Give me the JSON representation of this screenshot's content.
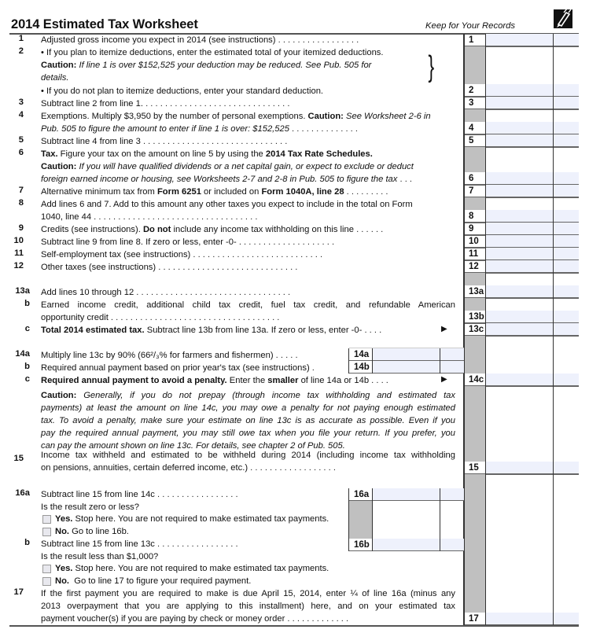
{
  "header": {
    "title": "2014 Estimated Tax Worksheet",
    "keep_note": "Keep for Your Records",
    "icon": "pencil-icon"
  },
  "lines": {
    "l1": {
      "num": "1",
      "text": "Adjusted gross income you expect in 2014 (see instructions)",
      "box": "1"
    },
    "l2": {
      "num": "2",
      "bullet1": "• If you plan to itemize deductions, enter the estimated total of your itemized deductions.",
      "caution_label": "Caution:",
      "caution_text": "If line 1 is over $152,525 your deduction may be reduced.  See Pub. 505 for",
      "caution_text2": "details.",
      "bullet2": "• If you do not plan to itemize deductions, enter your standard deduction.",
      "box": "2"
    },
    "l3": {
      "num": "3",
      "text": "Subtract line 2 from line 1.",
      "box": "3"
    },
    "l4": {
      "num": "4",
      "text": "Exemptions. Multiply $3,950 by the number of personal exemptions.",
      "caution_label": "Caution:",
      "caution_text": "See Worksheet 2-6 in",
      "text2": "Pub. 505 to figure the amount to enter if line 1 is over: $152,525",
      "box": "4"
    },
    "l5": {
      "num": "5",
      "text": "Subtract line 4 from line 3",
      "box": "5"
    },
    "l6": {
      "num": "6",
      "label": "Tax.",
      "text": "Figure your tax on the amount on line 5 by using the",
      "bold_ref": "2014 Tax Rate Schedules.",
      "caution_label": "Caution:",
      "caution_text": "If you will have qualified dividends or a net capital gain, or expect to exclude or deduct",
      "caution_text2": "foreign earned income or housing, see Worksheets 2-7 and 2-8 in Pub. 505 to figure the tax",
      "box": "6"
    },
    "l7": {
      "num": "7",
      "text": "Alternative minimum tax from",
      "form1": "Form 6251",
      "mid": "or included on",
      "form2": "Form 1040A, line 28",
      "box": "7"
    },
    "l8": {
      "num": "8",
      "text": "Add lines 6 and 7. Add to this amount any other taxes you expect to include in the total on Form",
      "text2": "1040, line 44",
      "box": "8"
    },
    "l9": {
      "num": "9",
      "text": "Credits (see instructions).",
      "bold": "Do not",
      "text_after": "include any income tax withholding on this line",
      "box": "9"
    },
    "l10": {
      "num": "10",
      "text": "Subtract line 9 from line 8. If zero or less, enter -0-",
      "box": "10"
    },
    "l11": {
      "num": "11",
      "text": "Self-employment tax (see instructions)",
      "box": "11"
    },
    "l12": {
      "num": "12",
      "text": "Other taxes (see instructions)",
      "box": "12"
    },
    "l13a": {
      "num": "13a",
      "text": "Add lines 10 through 12",
      "box": "13a"
    },
    "l13b": {
      "num": "b",
      "text": "Earned income credit, additional child tax credit, fuel tax credit, and refundable American",
      "text2": "opportunity credit",
      "box": "13b"
    },
    "l13c": {
      "num": "c",
      "bold": "Total 2014 estimated tax.",
      "text": "Subtract line 13b from line 13a. If zero or less, enter -0-",
      "box": "13c"
    },
    "l14a": {
      "num": "14a",
      "text": "Multiply line 13c by 90% (66²/₃% for farmers and fishermen)",
      "box": "14a"
    },
    "l14b": {
      "num": "b",
      "text": "Required annual payment based on prior year's tax (see instructions)",
      "box": "14b"
    },
    "l14c": {
      "num": "c",
      "bold": "Required annual payment to avoid a penalty.",
      "text": "Enter the",
      "bold2": "smaller",
      "text2": "of line 14a or 14b",
      "box": "14c"
    },
    "l14caution": {
      "label": "Caution:",
      "t1": "Generally, if you do not prepay (through income tax withholding and estimated tax",
      "t2": "payments) at least the amount on line 14c, you may owe a penalty for not paying enough estimated",
      "t3": "tax. To avoid a penalty, make sure your estimate on line 13c is as accurate as possible. Even if you",
      "t4": "pay the required annual payment, you may still owe tax when you file your return. If you prefer, you",
      "t5": "can pay the amount shown on line 13c. For details, see chapter 2 of Pub. 505."
    },
    "l15": {
      "num": "15",
      "text": "Income tax withheld and estimated to be withheld during 2014 (including income tax withholding",
      "text2": "on pensions, annuities, certain deferred income, etc.)",
      "box": "15"
    },
    "l16a": {
      "num": "16a",
      "text": "Subtract line 15 from line 14c",
      "question": "Is the result zero or less?",
      "yes_label": "Yes.",
      "yes_text": "Stop here. You are not required to make estimated tax payments.",
      "no_label": "No.",
      "no_text": "Go to line 16b.",
      "box": "16a",
      "yes_checked": false,
      "no_checked": false
    },
    "l16b": {
      "num": "b",
      "text": "Subtract line 15 from line 13c",
      "question": "Is the result less than $1,000?",
      "yes_label": "Yes.",
      "yes_text": "Stop here. You are not required to make estimated tax payments.",
      "no_label": "No.",
      "no_text": "Go to line 17 to figure your required payment.",
      "box": "16b",
      "yes_checked": false,
      "no_checked": false
    },
    "l17": {
      "num": "17",
      "text": "If the first payment you are required to make is due April 15, 2014, enter ¼ of line 16a (minus any",
      "text2": "2013 overpayment that you are applying to this installment) here, and on your estimated tax",
      "text3": "payment voucher(s) if you are paying by check or money order",
      "box": "17"
    }
  },
  "colors": {
    "field_fill": "#eef1fc",
    "shaded": "#c0c0c0",
    "rule": "#555555"
  },
  "symbols": {
    "arrow": "▶",
    "brace": "}"
  }
}
